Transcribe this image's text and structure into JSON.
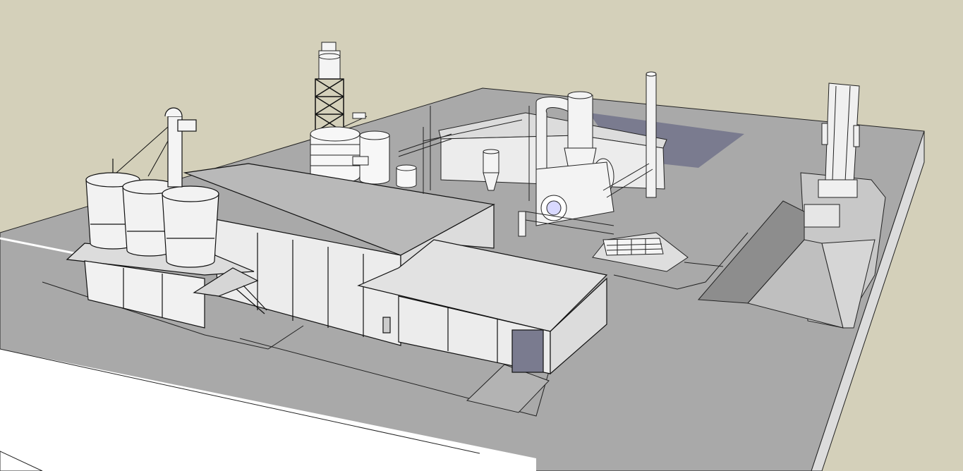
{
  "scene": {
    "type": "3d-model-render",
    "style": "monochrome sketch",
    "sky_color": "#d4d0ba",
    "ground_color": "#a8a8a8",
    "shadow_color": "#7a7b8f",
    "roof_light": "#d8d8d8",
    "wall_color": "#ececec",
    "components": [
      "storage-silos",
      "bucket-elevator",
      "main-warehouse",
      "side-annex",
      "cyclone-tower",
      "storage-tanks",
      "rotary-dryer",
      "dust-collector-cyclone",
      "exhaust-stack",
      "rear-shed",
      "brick-wall",
      "ramp-conveyor",
      "truck-dump-hopper"
    ]
  }
}
